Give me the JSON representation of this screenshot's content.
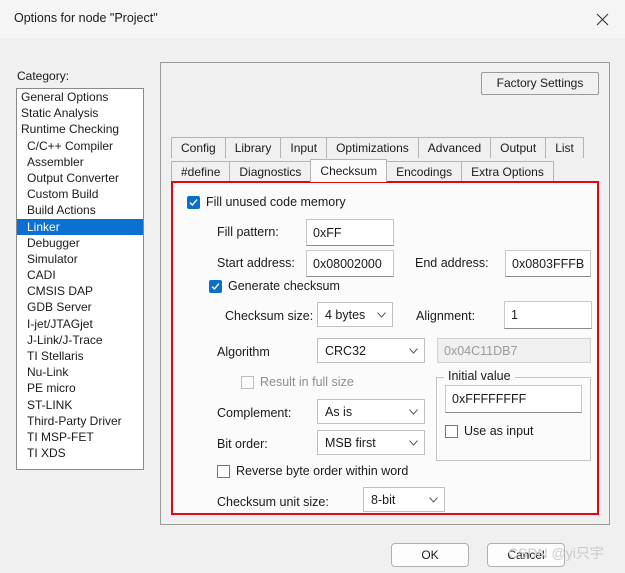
{
  "window": {
    "title": "Options for node \"Project\"",
    "close_icon": "close-icon"
  },
  "sidebar": {
    "label": "Category:",
    "items": [
      {
        "label": "General Options",
        "indent": false,
        "selected": false
      },
      {
        "label": "Static Analysis",
        "indent": false,
        "selected": false
      },
      {
        "label": "Runtime Checking",
        "indent": false,
        "selected": false
      },
      {
        "label": "C/C++ Compiler",
        "indent": true,
        "selected": false
      },
      {
        "label": "Assembler",
        "indent": true,
        "selected": false
      },
      {
        "label": "Output Converter",
        "indent": true,
        "selected": false
      },
      {
        "label": "Custom Build",
        "indent": true,
        "selected": false
      },
      {
        "label": "Build Actions",
        "indent": true,
        "selected": false
      },
      {
        "label": "Linker",
        "indent": true,
        "selected": true
      },
      {
        "label": "Debugger",
        "indent": true,
        "selected": false
      },
      {
        "label": "Simulator",
        "indent": true,
        "selected": false
      },
      {
        "label": "CADI",
        "indent": true,
        "selected": false
      },
      {
        "label": "CMSIS DAP",
        "indent": true,
        "selected": false
      },
      {
        "label": "GDB Server",
        "indent": true,
        "selected": false
      },
      {
        "label": "I-jet/JTAGjet",
        "indent": true,
        "selected": false
      },
      {
        "label": "J-Link/J-Trace",
        "indent": true,
        "selected": false
      },
      {
        "label": "TI Stellaris",
        "indent": true,
        "selected": false
      },
      {
        "label": "Nu-Link",
        "indent": true,
        "selected": false
      },
      {
        "label": "PE micro",
        "indent": true,
        "selected": false
      },
      {
        "label": "ST-LINK",
        "indent": true,
        "selected": false
      },
      {
        "label": "Third-Party Driver",
        "indent": true,
        "selected": false
      },
      {
        "label": "TI MSP-FET",
        "indent": true,
        "selected": false
      },
      {
        "label": "TI XDS",
        "indent": true,
        "selected": false
      }
    ]
  },
  "panel": {
    "factory_settings_label": "Factory Settings",
    "tabs_row1": [
      {
        "label": "Config",
        "active": false
      },
      {
        "label": "Library",
        "active": false
      },
      {
        "label": "Input",
        "active": false
      },
      {
        "label": "Optimizations",
        "active": false
      },
      {
        "label": "Advanced",
        "active": false
      },
      {
        "label": "Output",
        "active": false
      },
      {
        "label": "List",
        "active": false
      }
    ],
    "tabs_row2": [
      {
        "label": "#define",
        "active": false
      },
      {
        "label": "Diagnostics",
        "active": false
      },
      {
        "label": "Checksum",
        "active": true
      },
      {
        "label": "Encodings",
        "active": false
      },
      {
        "label": "Extra Options",
        "active": false
      }
    ]
  },
  "checksum": {
    "fill_unused_label": "Fill unused code memory",
    "fill_unused_checked": true,
    "fill_pattern_label": "Fill pattern:",
    "fill_pattern_value": "0xFF",
    "start_address_label": "Start address:",
    "start_address_value": "0x08002000",
    "end_address_label": "End address:",
    "end_address_value": "0x0803FFFB",
    "generate_checksum_label": "Generate checksum",
    "generate_checksum_checked": true,
    "checksum_size_label": "Checksum size:",
    "checksum_size_value": "4 bytes",
    "alignment_label": "Alignment:",
    "alignment_value": "1",
    "algorithm_label": "Algorithm",
    "algorithm_value": "CRC32",
    "polynomial_value": "0x04C11DB7",
    "result_full_size_label": "Result in full size",
    "result_full_size_checked": false,
    "complement_label": "Complement:",
    "complement_value": "As is",
    "bit_order_label": "Bit order:",
    "bit_order_value": "MSB first",
    "reverse_byte_order_label": "Reverse byte order within word",
    "reverse_byte_order_checked": false,
    "checksum_unit_size_label": "Checksum unit size:",
    "checksum_unit_size_value": "8-bit",
    "initial_value_group_label": "Initial value",
    "initial_value": "0xFFFFFFFF",
    "use_as_input_label": "Use as input",
    "use_as_input_checked": false,
    "highlight_color": "#e30613"
  },
  "footer": {
    "ok_label": "OK",
    "cancel_label": "Cancel",
    "watermark": "CSDN @yi只宇"
  }
}
